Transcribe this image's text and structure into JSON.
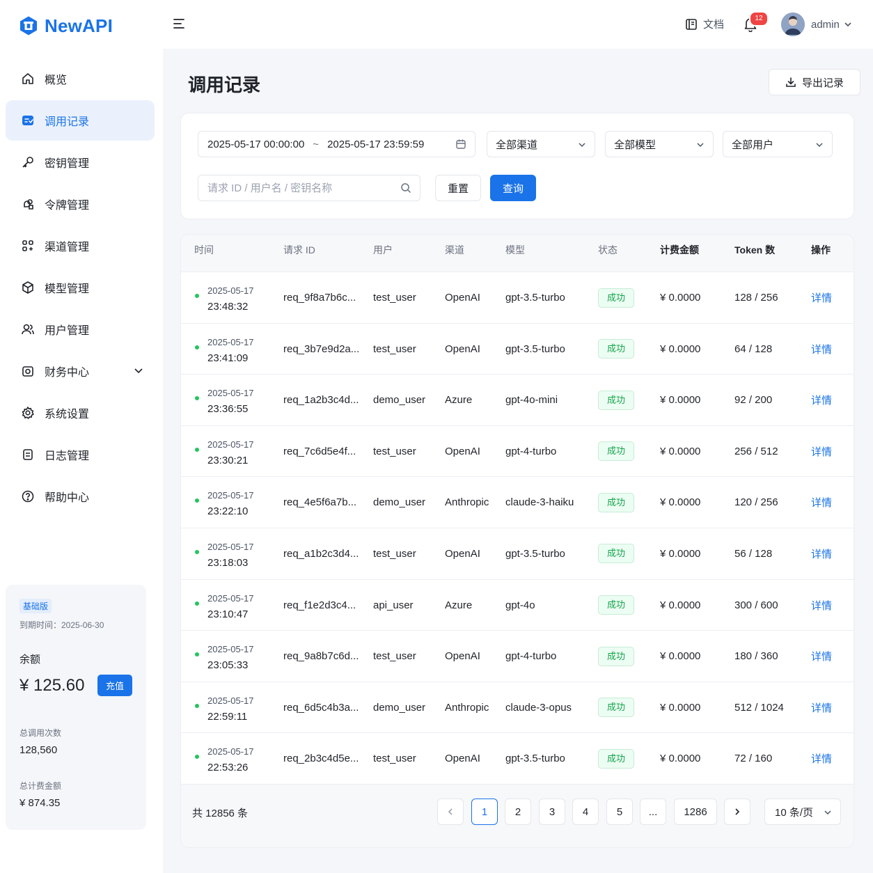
{
  "brand": {
    "name": "NewAPI"
  },
  "sidebar": {
    "items": [
      {
        "label": "概览",
        "icon": "home-icon"
      },
      {
        "label": "调用记录",
        "icon": "records-icon",
        "active": true
      },
      {
        "label": "密钥管理",
        "icon": "key-icon"
      },
      {
        "label": "令牌管理",
        "icon": "token-icon"
      },
      {
        "label": "渠道管理",
        "icon": "channel-icon"
      },
      {
        "label": "模型管理",
        "icon": "model-icon"
      },
      {
        "label": "用户管理",
        "icon": "users-icon"
      },
      {
        "label": "财务中心",
        "icon": "finance-icon",
        "expandable": true
      },
      {
        "label": "系统设置",
        "icon": "gear-icon"
      },
      {
        "label": "日志管理",
        "icon": "log-icon"
      },
      {
        "label": "帮助中心",
        "icon": "help-icon"
      }
    ],
    "plan": {
      "badge": "基础版",
      "expire": "到期时间：2025-06-30",
      "balance_label": "余额",
      "balance_value": "¥ 125.60",
      "recharge_label": "充值",
      "total_calls_label": "总调用次数",
      "total_calls_value": "128,560",
      "total_cost_label": "总计费金额",
      "total_cost_value": "¥ 874.35"
    }
  },
  "header": {
    "docs_label": "文档",
    "notification_count": "12",
    "username": "admin"
  },
  "main": {
    "title": "调用记录",
    "export_label": "导出记录"
  },
  "filters": {
    "date_start": "2025-05-17 00:00:00",
    "date_sep": "~",
    "date_end": "2025-05-17 23:59:59",
    "channel": "全部渠道",
    "model": "全部模型",
    "user": "全部用户",
    "search_placeholder": "请求 ID / 用户名 / 密钥名称",
    "reset_label": "重置",
    "query_label": "查询"
  },
  "table": {
    "columns": [
      "时间",
      "请求 ID",
      "用户",
      "渠道",
      "模型",
      "状态",
      "计费金额",
      "Token 数",
      "操作"
    ],
    "rows": [
      {
        "date": "2025-05-17",
        "time": "23:48:32",
        "req_id": "req_9f8a7b6c...",
        "user": "test_user",
        "channel": "OpenAI",
        "model": "gpt-3.5-turbo",
        "status": "成功",
        "amount": "¥ 0.0000",
        "tokens": "128 / 256",
        "action": "详情"
      },
      {
        "date": "2025-05-17",
        "time": "23:41:09",
        "req_id": "req_3b7e9d2a...",
        "user": "test_user",
        "channel": "OpenAI",
        "model": "gpt-3.5-turbo",
        "status": "成功",
        "amount": "¥ 0.0000",
        "tokens": "64 / 128",
        "action": "详情"
      },
      {
        "date": "2025-05-17",
        "time": "23:36:55",
        "req_id": "req_1a2b3c4d...",
        "user": "demo_user",
        "channel": "Azure",
        "model": "gpt-4o-mini",
        "status": "成功",
        "amount": "¥ 0.0000",
        "tokens": "92 / 200",
        "action": "详情"
      },
      {
        "date": "2025-05-17",
        "time": "23:30:21",
        "req_id": "req_7c6d5e4f...",
        "user": "test_user",
        "channel": "OpenAI",
        "model": "gpt-4-turbo",
        "status": "成功",
        "amount": "¥ 0.0000",
        "tokens": "256 / 512",
        "action": "详情"
      },
      {
        "date": "2025-05-17",
        "time": "23:22:10",
        "req_id": "req_4e5f6a7b...",
        "user": "demo_user",
        "channel": "Anthropic",
        "model": "claude-3-haiku",
        "status": "成功",
        "amount": "¥ 0.0000",
        "tokens": "120 / 256",
        "action": "详情"
      },
      {
        "date": "2025-05-17",
        "time": "23:18:03",
        "req_id": "req_a1b2c3d4...",
        "user": "test_user",
        "channel": "OpenAI",
        "model": "gpt-3.5-turbo",
        "status": "成功",
        "amount": "¥ 0.0000",
        "tokens": "56 / 128",
        "action": "详情"
      },
      {
        "date": "2025-05-17",
        "time": "23:10:47",
        "req_id": "req_f1e2d3c4...",
        "user": "api_user",
        "channel": "Azure",
        "model": "gpt-4o",
        "status": "成功",
        "amount": "¥ 0.0000",
        "tokens": "300 / 600",
        "action": "详情"
      },
      {
        "date": "2025-05-17",
        "time": "23:05:33",
        "req_id": "req_9a8b7c6d...",
        "user": "test_user",
        "channel": "OpenAI",
        "model": "gpt-4-turbo",
        "status": "成功",
        "amount": "¥ 0.0000",
        "tokens": "180 / 360",
        "action": "详情"
      },
      {
        "date": "2025-05-17",
        "time": "22:59:11",
        "req_id": "req_6d5c4b3a...",
        "user": "demo_user",
        "channel": "Anthropic",
        "model": "claude-3-opus",
        "status": "成功",
        "amount": "¥ 0.0000",
        "tokens": "512 / 1024",
        "action": "详情"
      },
      {
        "date": "2025-05-17",
        "time": "22:53:26",
        "req_id": "req_2b3c4d5e...",
        "user": "test_user",
        "channel": "OpenAI",
        "model": "gpt-3.5-turbo",
        "status": "成功",
        "amount": "¥ 0.0000",
        "tokens": "72 / 160",
        "action": "详情"
      }
    ]
  },
  "pagination": {
    "total": "共 12856 条",
    "pages": [
      "1",
      "2",
      "3",
      "4",
      "5",
      "...",
      "1286"
    ],
    "current": "1",
    "page_size": "10 条/页"
  },
  "colors": {
    "accent": "#1a73e8",
    "success": "#16a34a",
    "danger": "#ef4444"
  }
}
